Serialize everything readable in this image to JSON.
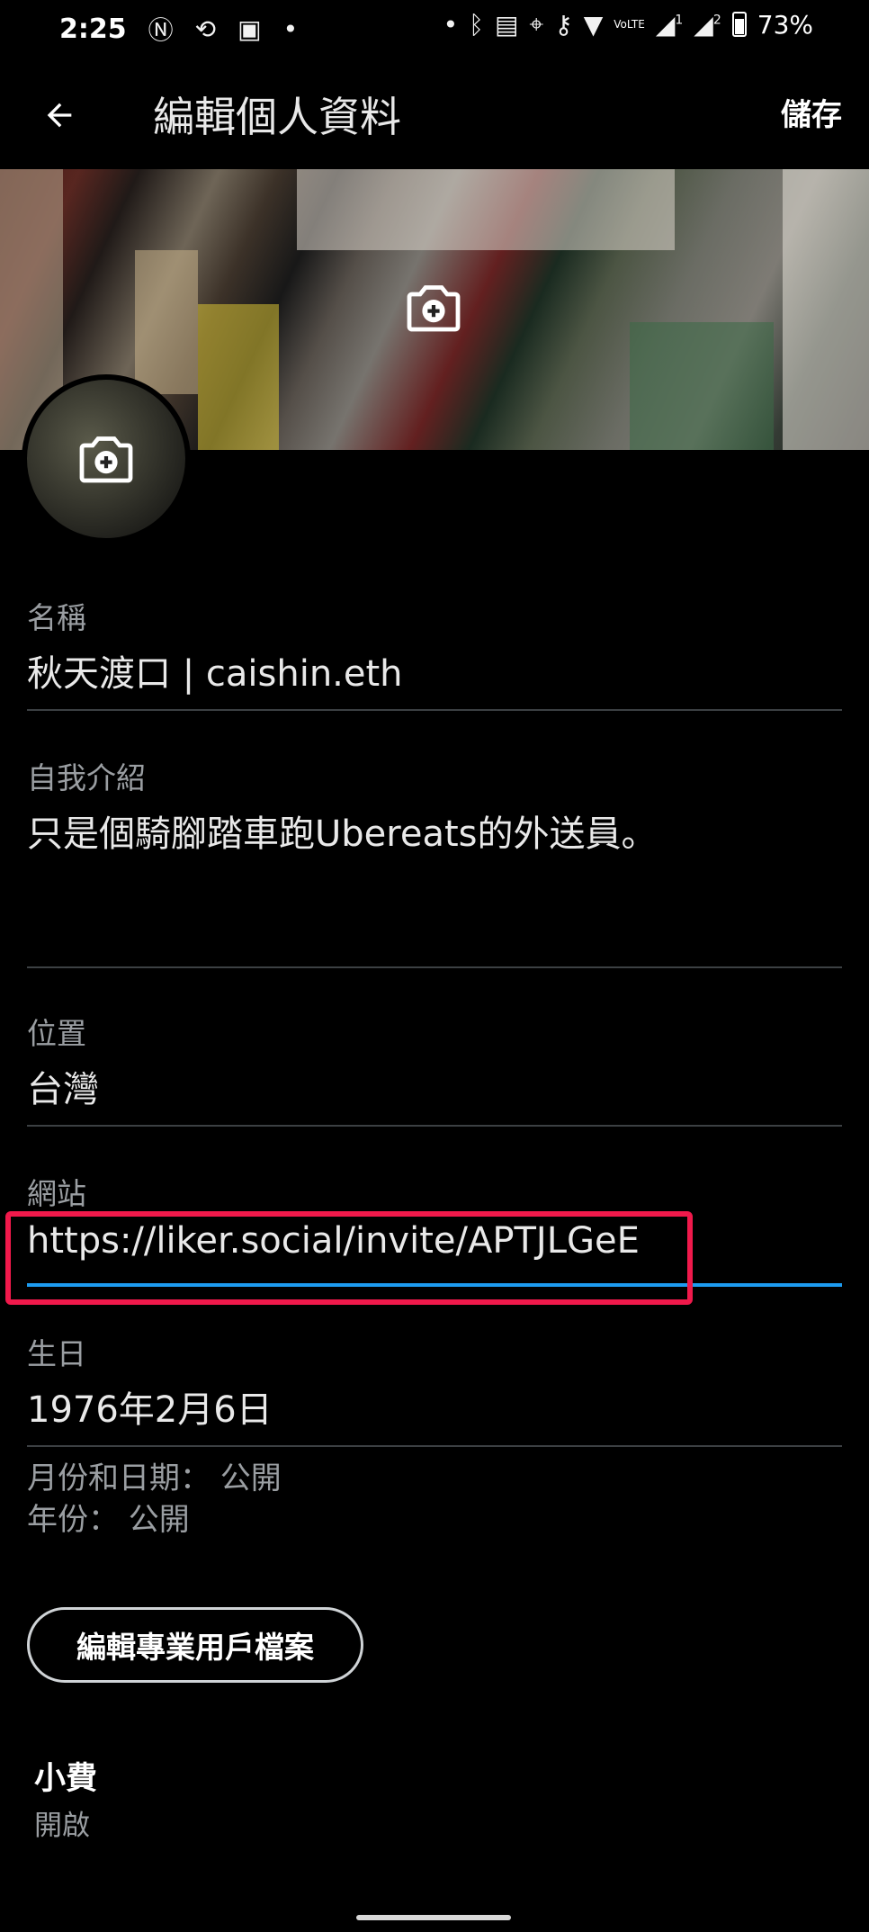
{
  "status_bar": {
    "time": "2:25",
    "left_icons": [
      "nfc-icon",
      "sync-icon",
      "image-icon",
      "dot-icon"
    ],
    "right_icons": [
      "dot-icon",
      "bluetooth-icon",
      "nfc-chip-icon",
      "location-icon",
      "vpn-key-icon",
      "wifi-icon",
      "volte-icon",
      "signal-1-icon",
      "signal-2-icon",
      "battery-icon"
    ],
    "volte": "VoLTE",
    "sim1": "1",
    "sim2": "2",
    "battery": "73%"
  },
  "appbar": {
    "title": "編輯個人資料",
    "save_label": "儲存"
  },
  "fields": {
    "name": {
      "label": "名稱",
      "value": "秋天渡口 | caishin.eth"
    },
    "bio": {
      "label": "自我介紹",
      "value": "只是個騎腳踏車跑Ubereats的外送員。"
    },
    "location": {
      "label": "位置",
      "value": "台灣"
    },
    "website": {
      "label": "網站",
      "value": "https://liker.social/invite/APTJLGeE"
    },
    "birthday": {
      "label": "生日",
      "value": "1976年2月6日"
    }
  },
  "privacy": {
    "month_day": "月份和日期： 公開",
    "year": "年份： 公開"
  },
  "pro_button": "編輯專業用戶檔案",
  "tips": {
    "title": "小費",
    "subtitle": "開啟"
  },
  "colors": {
    "background": "#000000",
    "accent": "#1d9bf0",
    "highlight": "#f0194b",
    "secondary_text": "#9a9ea2",
    "divider": "#3c4043"
  }
}
